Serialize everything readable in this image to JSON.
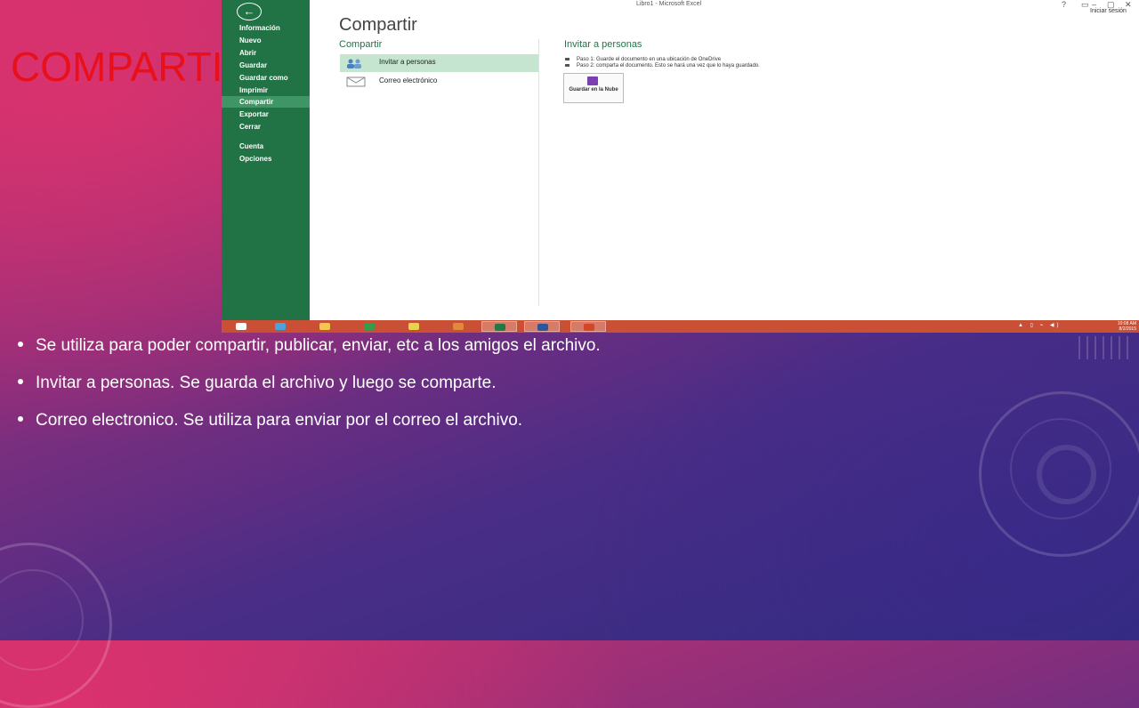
{
  "slide": {
    "title": "COMPARTI",
    "bullets": [
      "Se utiliza para poder compartir, publicar, enviar, etc a los amigos el archivo.",
      "Invitar a personas. Se guarda el archivo y luego se comparte.",
      "Correo electronico. Se utiliza para enviar por el correo el archivo."
    ]
  },
  "excel": {
    "window_title": "Libro1 - Microsoft Excel",
    "window_controls": [
      "?",
      "▭",
      "–",
      "▢",
      "✕"
    ],
    "sign_in": "Iniciar sesión",
    "back_icon": "back-arrow-icon",
    "backstage_items": [
      {
        "label": "Información",
        "active": false
      },
      {
        "label": "Nuevo",
        "active": false
      },
      {
        "label": "Abrir",
        "active": false
      },
      {
        "label": "Guardar",
        "active": false
      },
      {
        "label": "Guardar como",
        "active": false
      },
      {
        "label": "Imprimir",
        "active": false
      },
      {
        "label": "Compartir",
        "active": true
      },
      {
        "label": "Exportar",
        "active": false
      },
      {
        "label": "Cerrar",
        "active": false
      },
      {
        "label": "Cuenta",
        "active": false
      },
      {
        "label": "Opciones",
        "active": false
      }
    ],
    "page_title": "Compartir",
    "section_title": "Compartir",
    "share_options": [
      {
        "label": "Invitar a personas",
        "icon": "people-icon",
        "selected": true
      },
      {
        "label": "Correo electrónico",
        "icon": "email-icon",
        "selected": false
      }
    ],
    "right_title": "Invitar a personas",
    "steps": [
      "Paso 1: Guarde el documento en una ubicación de OneDrive",
      "Paso 2: comparta el documento. Esto se hará una vez que lo haya guardado."
    ],
    "save_button_label": "Guardar en la Nube",
    "accent_color": "#217346"
  },
  "taskbar": {
    "apps": [
      "windows-start-icon",
      "internet-explorer-icon",
      "file-explorer-icon",
      "store-icon",
      "chrome-icon",
      "paint-icon",
      "excel-icon",
      "word-icon",
      "powerpoint-icon"
    ],
    "active_apps": [
      "excel-icon",
      "word-icon",
      "powerpoint-icon"
    ],
    "tray": "▲ ▯ ⌁ ◀)",
    "time": "10:08 AM",
    "date": "8/2/2015"
  }
}
